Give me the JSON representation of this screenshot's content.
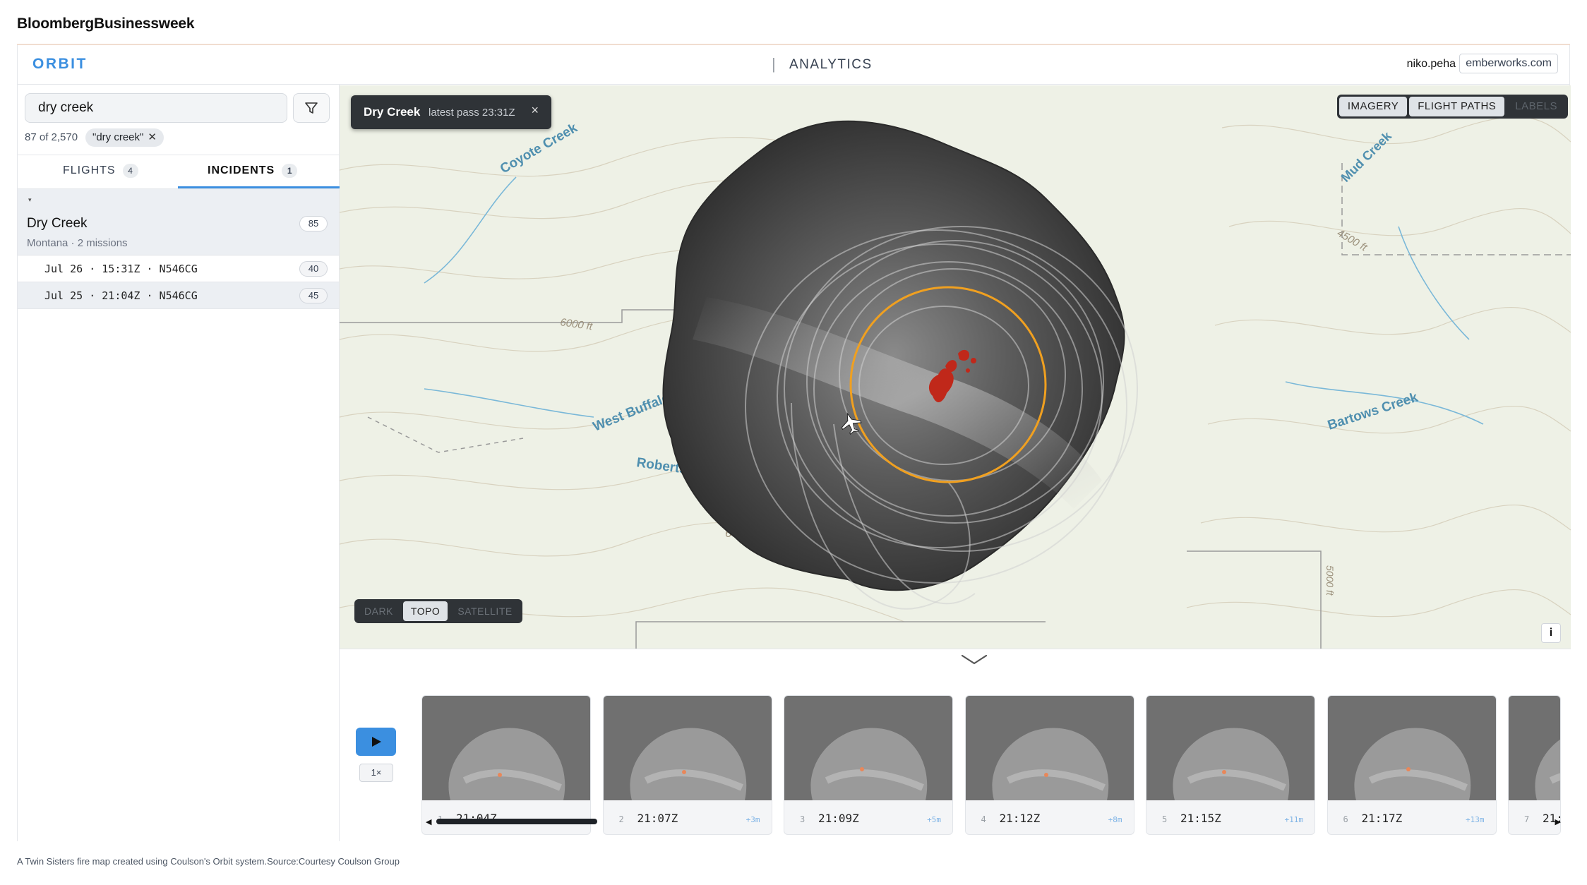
{
  "masthead": "BloombergBusinessweek",
  "topbar": {
    "brand": "ORBIT",
    "nav_separator": "|",
    "nav_item": "ANALYTICS",
    "user": "niko.peha",
    "org": "emberworks.com"
  },
  "sidebar": {
    "search_value": "dry creek",
    "filter_icon": "filter-icon",
    "count_text": "87 of 2,570",
    "chip_label": "\"dry creek\"",
    "chip_close": "✕",
    "tabs": [
      {
        "label": "FLIGHTS",
        "count": "4"
      },
      {
        "label": "INCIDENTS",
        "count": "1"
      }
    ],
    "active_tab": "INCIDENTS",
    "incident": {
      "caret": "▾",
      "name": "Dry Creek",
      "subtitle": "Montana · 2 missions",
      "count": "85"
    },
    "missions": [
      {
        "label": "Jul 26 · 15:31Z · N546CG",
        "count": "40"
      },
      {
        "label": "Jul 25 · 21:04Z · N546CG",
        "count": "45"
      }
    ]
  },
  "map": {
    "popup_title": "Dry Creek",
    "popup_subtitle": "latest pass 23:31Z",
    "popup_close": "×",
    "layer_buttons": [
      {
        "label": "IMAGERY",
        "active": true
      },
      {
        "label": "FLIGHT PATHS",
        "active": true
      },
      {
        "label": "LABELS",
        "active": false
      }
    ],
    "basemap_buttons": [
      {
        "label": "DARK",
        "active": false
      },
      {
        "label": "TOPO",
        "active": true
      },
      {
        "label": "SATELLITE",
        "active": false
      }
    ],
    "info_label": "i",
    "labels": {
      "coyote_creek": "Coyote Creek",
      "mud_creek": "Mud Creek",
      "elev_4500": "4500 ft",
      "elev_6000": "6000 ft",
      "west_buffalo": "West Buffalo C",
      "roberts": "Roberts C",
      "bartows": "Bartows Creek",
      "elev_6747": "6747 ft",
      "elev_5000": "5000 ft"
    },
    "colors": {
      "accent": "#3b8fe0",
      "orbit": "#f0a020",
      "fire": "#c0281a"
    }
  },
  "timeline": {
    "play_icon": "play-icon",
    "speed": "1×",
    "frames": [
      {
        "n": "1",
        "time": "21:04Z",
        "delta": ""
      },
      {
        "n": "2",
        "time": "21:07Z",
        "delta": "+3m"
      },
      {
        "n": "3",
        "time": "21:09Z",
        "delta": "+5m"
      },
      {
        "n": "4",
        "time": "21:12Z",
        "delta": "+8m"
      },
      {
        "n": "5",
        "time": "21:15Z",
        "delta": "+11m"
      },
      {
        "n": "6",
        "time": "21:17Z",
        "delta": "+13m"
      },
      {
        "n": "7",
        "time": "21:",
        "delta": ""
      }
    ],
    "scroll_left": "◀",
    "scroll_right": "▶"
  },
  "caption": "A Twin Sisters fire map created using Coulson's Orbit system.Source:Courtesy Coulson Group"
}
